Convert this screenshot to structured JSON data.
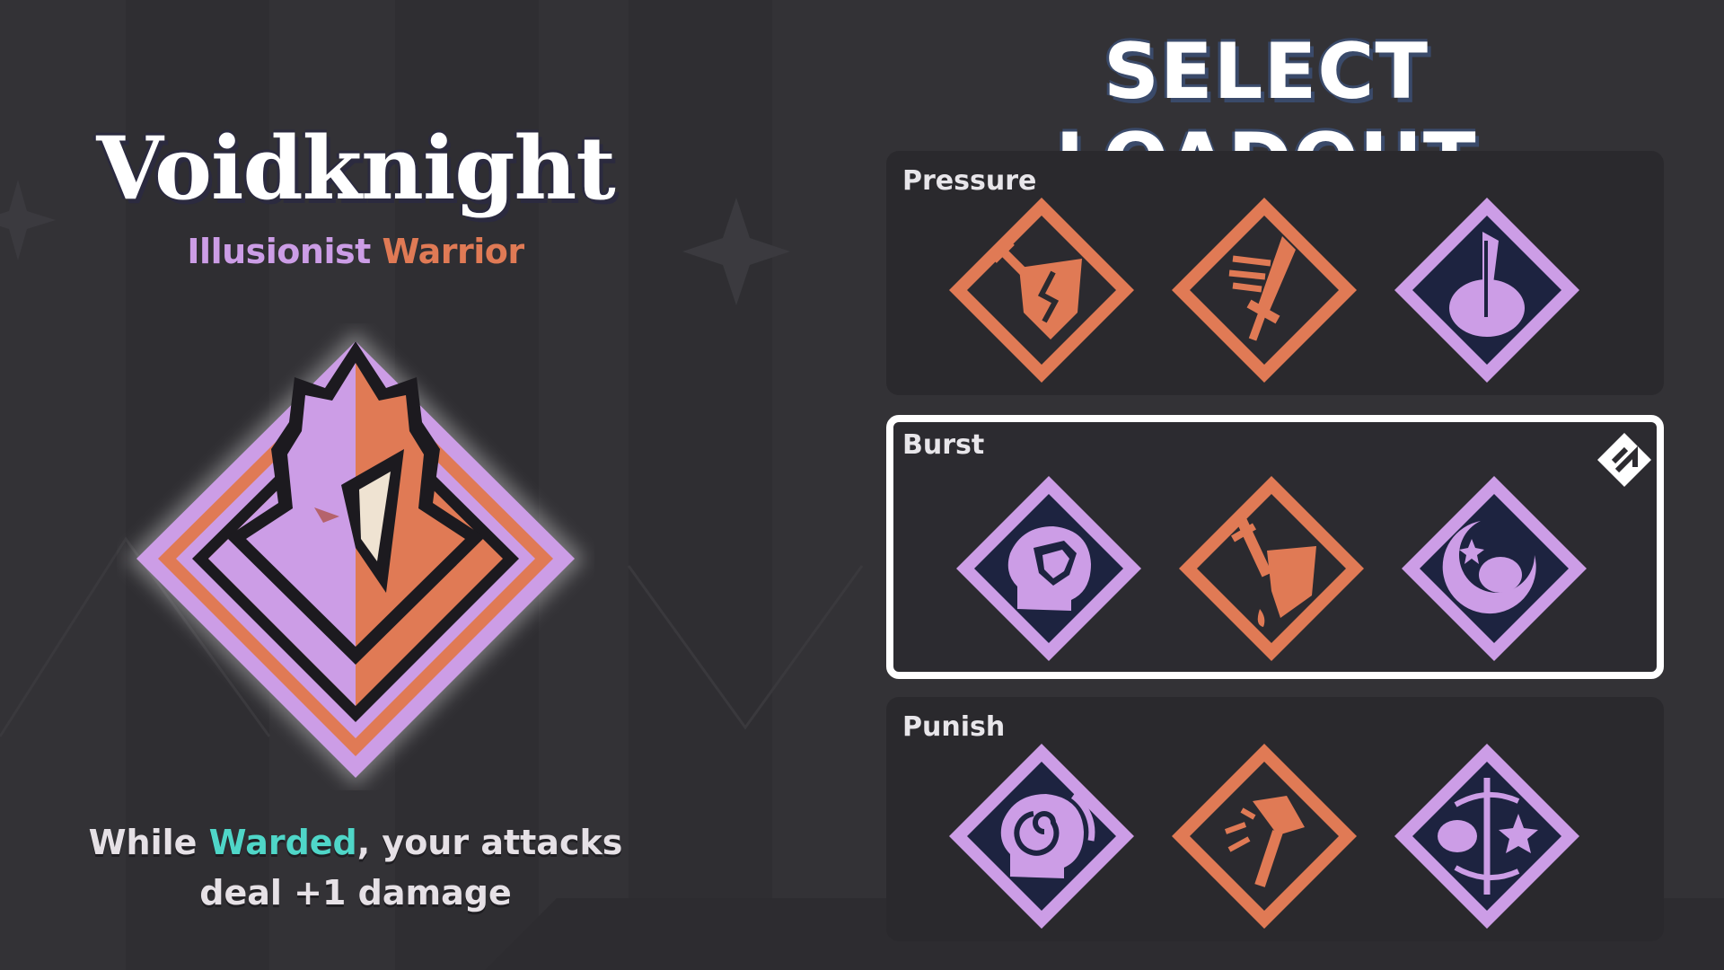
{
  "hero": {
    "name": "Voidknight",
    "class_a": "Illusionist",
    "class_b": "Warrior",
    "passive_prefix": "While ",
    "passive_keyword": "Warded",
    "passive_suffix": ", your attacks",
    "passive_line2": "deal +1 damage",
    "emblem_icon": "voidknight-helmet-icon"
  },
  "panel": {
    "title": "SELECT LOADOUT"
  },
  "colors": {
    "background": "#333236",
    "illusionist": "#cc9de6",
    "warrior": "#e07a55",
    "keyword": "#4fd6c8",
    "skill_bg": "#1d2340"
  },
  "loadouts": [
    {
      "name": "Pressure",
      "selected": false,
      "skills": [
        {
          "icon": "sword-shield-break-icon",
          "school": "warrior"
        },
        {
          "icon": "winged-sword-icon",
          "school": "warrior"
        },
        {
          "icon": "blade-brain-icon",
          "school": "illusionist"
        }
      ]
    },
    {
      "name": "Burst",
      "selected": true,
      "equipped_icon": "equipped-marker-icon",
      "skills": [
        {
          "icon": "mind-shield-icon",
          "school": "illusionist"
        },
        {
          "icon": "sword-bleed-shield-icon",
          "school": "warrior"
        },
        {
          "icon": "moon-brain-icon",
          "school": "illusionist"
        }
      ]
    },
    {
      "name": "Punish",
      "selected": false,
      "skills": [
        {
          "icon": "spiral-mind-icon",
          "school": "illusionist"
        },
        {
          "icon": "hammer-strike-icon",
          "school": "warrior"
        },
        {
          "icon": "brain-star-swap-icon",
          "school": "illusionist"
        }
      ]
    }
  ]
}
